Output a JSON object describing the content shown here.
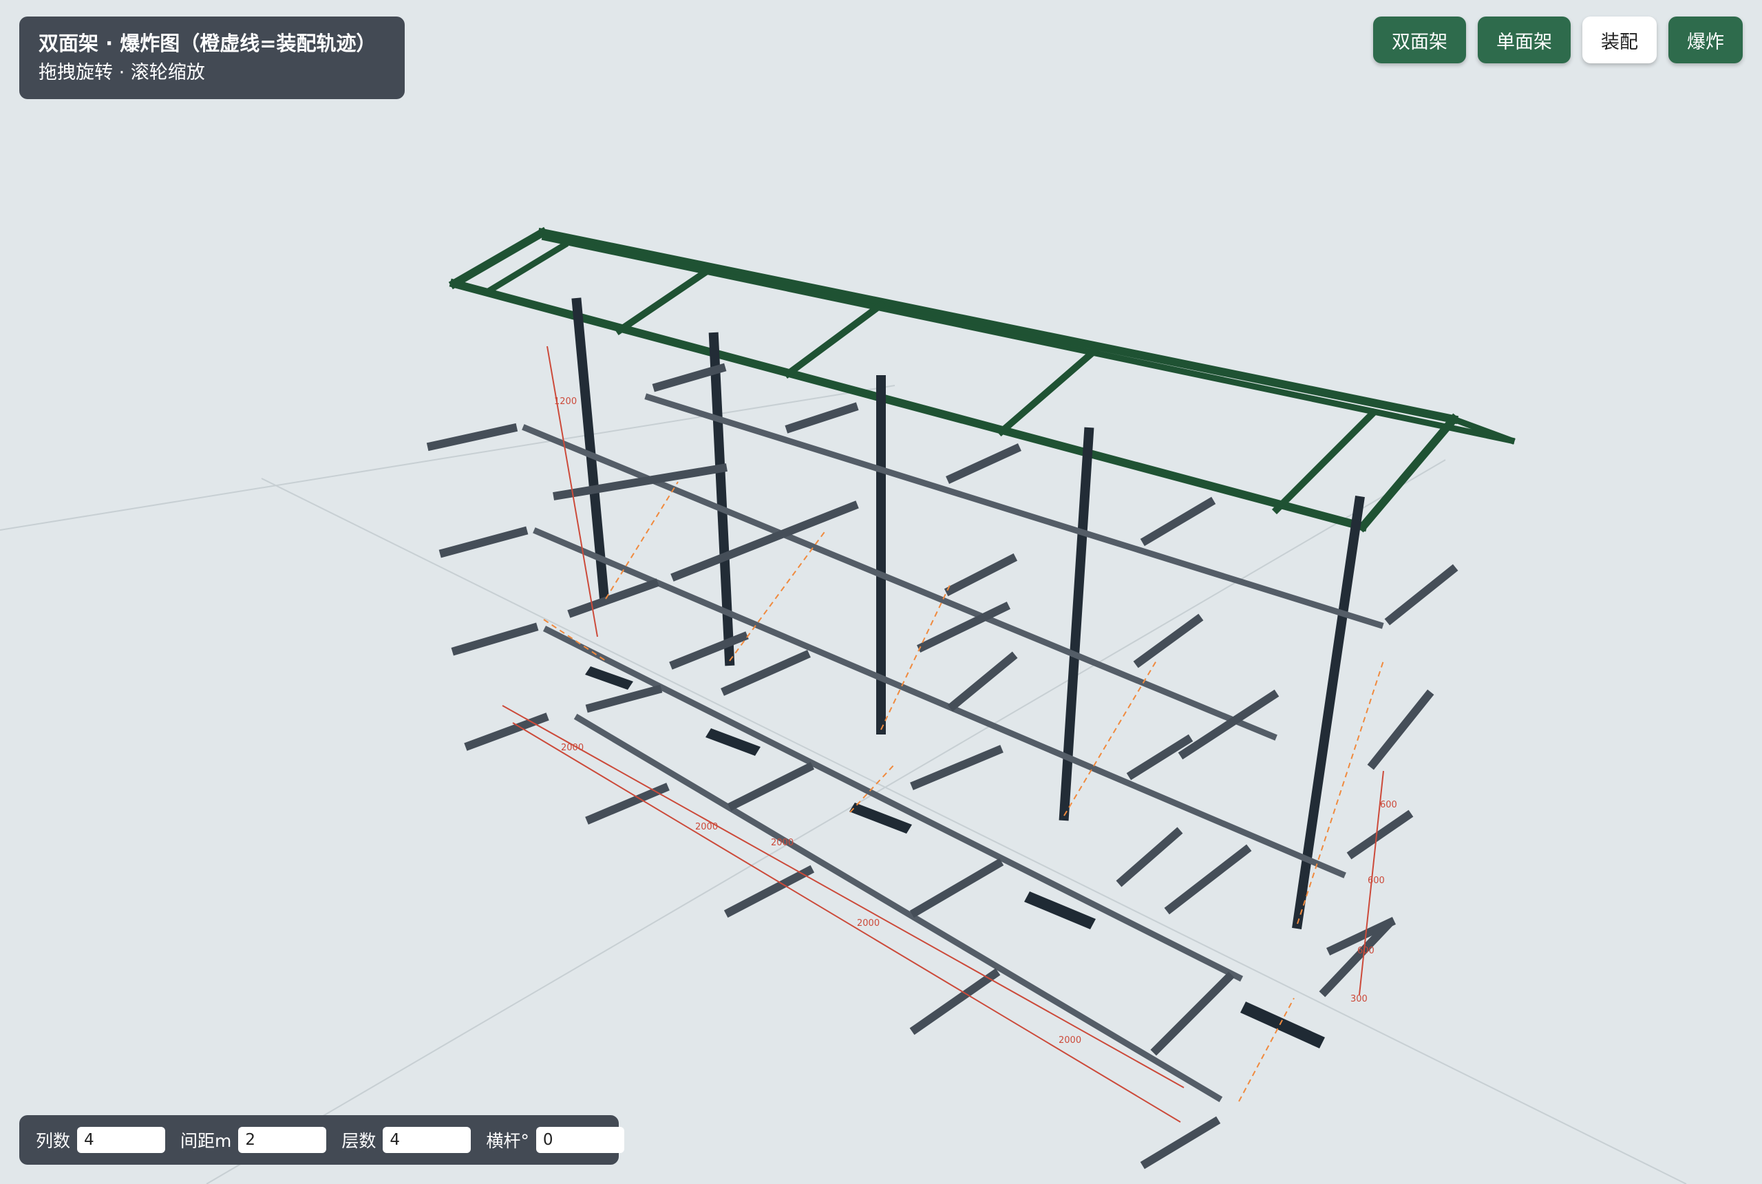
{
  "info": {
    "title": "双面架 · 爆炸图（橙虚线=装配轨迹）",
    "hint": "拖拽旋转 · 滚轮缩放"
  },
  "buttons": [
    {
      "label": "双面架",
      "active": false
    },
    {
      "label": "单面架",
      "active": false
    },
    {
      "label": "装配",
      "active": true
    },
    {
      "label": "爆炸",
      "active": false
    }
  ],
  "controls": [
    {
      "label": "列数",
      "value": "4"
    },
    {
      "label": "间距m",
      "value": "2"
    },
    {
      "label": "层数",
      "value": "4"
    },
    {
      "label": "横杆°",
      "value": "0"
    }
  ],
  "dimensions": {
    "bay_lengths": [
      "2000",
      "2000",
      "2000",
      "2000"
    ],
    "side_bay": "2000",
    "upright_height": "1200",
    "level_spacings": [
      "600",
      "600",
      "300"
    ],
    "level_label": "600"
  },
  "colors": {
    "background": "#e1e7ea",
    "panel": "#434a54",
    "button": "#2e6b4c",
    "roof_frame": "#1f5233",
    "upright": "#222c36",
    "arm": "#454e58",
    "dimension": "#cc4a3a",
    "trajectory": "#f08a3e"
  }
}
